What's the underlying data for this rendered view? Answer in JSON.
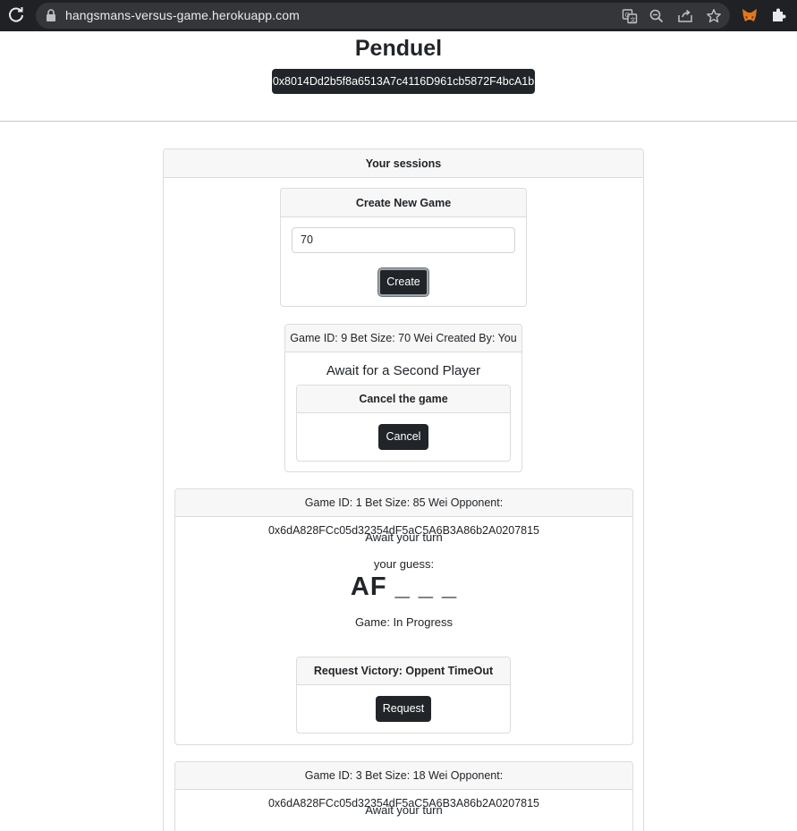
{
  "browser": {
    "url": "hangsmans-versus-game.herokuapp.com",
    "icons": [
      "reload-icon",
      "lock-icon",
      "translate-icon",
      "zoom-icon",
      "share-icon",
      "bookmark-star-icon",
      "metamask-icon",
      "extensions-icon"
    ]
  },
  "page": {
    "title": "Penduel",
    "account_address": "0x8014Dd2b5f8a6513A7c4116D961cb5872F4bcA1b"
  },
  "sessions": {
    "header": "Your sessions",
    "create": {
      "header": "Create New Game",
      "bet_value": "70",
      "button": "Create"
    },
    "games": [
      {
        "header": "Game ID: 9 Bet Size: 70 Wei Created By: You",
        "status": "Await for a Second Player",
        "action_header": "Cancel the game",
        "action_button": "Cancel"
      },
      {
        "header": "Game ID: 1 Bet Size: 85 Wei Opponent: 0x6dA828FCc05d32354dF5aC5A6B3A86b2A0207815",
        "turn": "Await your turn",
        "guess_label": "your guess:",
        "word": "AF _ _ _",
        "game_state": "Game: In Progress",
        "action_header": "Request Victory: Oppent TimeOut",
        "action_button": "Request"
      },
      {
        "header": "Game ID: 3 Bet Size: 18 Wei Opponent: 0x6dA828FCc05d32354dF5aC5A6B3A86b2A0207815",
        "turn": "Await your turn"
      }
    ]
  },
  "colors": {
    "chrome_bg": "#202124",
    "omnibox_bg": "#35363a",
    "dark_button": "#212529",
    "card_header_bg": "#f7f7f7",
    "card_border": "#dcdcdc"
  }
}
